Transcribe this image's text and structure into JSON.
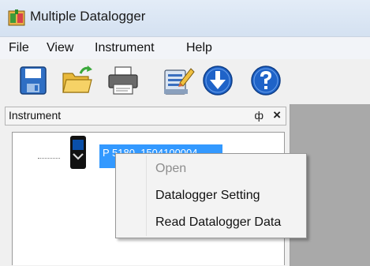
{
  "window": {
    "title": "Multiple Datalogger",
    "icon": "datalogger-app-icon"
  },
  "menubar": {
    "items": [
      {
        "label": "File"
      },
      {
        "label": "View"
      },
      {
        "label": "Instrument"
      },
      {
        "label": "Help"
      }
    ]
  },
  "toolbar": {
    "buttons": [
      {
        "icon": "save-icon"
      },
      {
        "icon": "open-folder-icon"
      },
      {
        "icon": "print-icon"
      },
      {
        "icon": "edit-settings-icon"
      },
      {
        "icon": "download-icon"
      },
      {
        "icon": "help-icon"
      }
    ]
  },
  "panel": {
    "title": "Instrument",
    "pin_glyph": "ф",
    "close_glyph": "×",
    "tree": {
      "selected_node": "P 5180_1504100004"
    }
  },
  "context_menu": {
    "items": [
      {
        "label": "Open",
        "enabled": false
      },
      {
        "label": "Datalogger Setting",
        "enabled": true
      },
      {
        "label": "Read Datalogger Data",
        "enabled": true
      }
    ]
  },
  "colors": {
    "selection": "#3399ff",
    "help_blue": "#1f63c8",
    "dock_gray": "#a9a9a9"
  }
}
